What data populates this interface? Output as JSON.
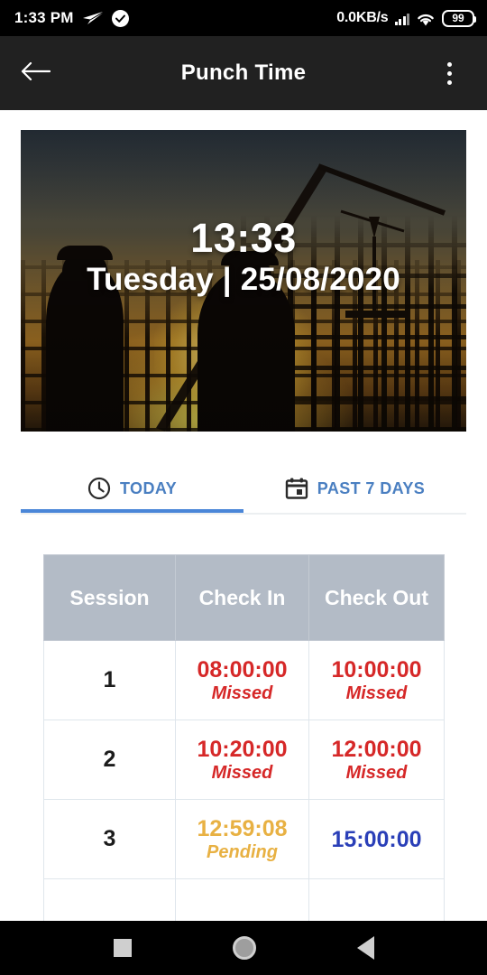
{
  "status_bar": {
    "time": "1:33 PM",
    "send_icon": "send-icon",
    "check_icon": "check-circle-icon",
    "network_speed": "0.0KB/s",
    "signal_icon": "signal-bars-icon",
    "wifi_icon": "wifi-icon",
    "battery_level": "99"
  },
  "app_bar": {
    "back_icon": "back-arrow-icon",
    "title": "Punch Time",
    "overflow_icon": "overflow-menu-icon"
  },
  "hero": {
    "time": "13:33",
    "date": "Tuesday | 25/08/2020"
  },
  "tabs": {
    "items": [
      {
        "label": "TODAY",
        "icon": "clock-icon",
        "active": true
      },
      {
        "label": "PAST 7 DAYS",
        "icon": "calendar-icon",
        "active": false
      }
    ]
  },
  "table": {
    "headers": [
      "Session",
      "Check In",
      "Check Out"
    ],
    "rows": [
      {
        "session": "1",
        "check_in": {
          "time": "08:00:00",
          "status": "Missed",
          "state": "missed"
        },
        "check_out": {
          "time": "10:00:00",
          "status": "Missed",
          "state": "missed"
        }
      },
      {
        "session": "2",
        "check_in": {
          "time": "10:20:00",
          "status": "Missed",
          "state": "missed"
        },
        "check_out": {
          "time": "12:00:00",
          "status": "Missed",
          "state": "missed"
        }
      },
      {
        "session": "3",
        "check_in": {
          "time": "12:59:08",
          "status": "Pending",
          "state": "pending"
        },
        "check_out": {
          "time": "15:00:00",
          "status": "",
          "state": "done"
        }
      }
    ]
  },
  "nav_bar": {
    "recents_icon": "recents-square-icon",
    "home_icon": "home-circle-icon",
    "back_icon": "back-triangle-icon"
  },
  "colors": {
    "accent_blue": "#4a86d8",
    "tab_text_blue": "#4a7fc1",
    "header_gray": "#b3bbc6",
    "missed_red": "#d62828",
    "pending_amber": "#e8b143",
    "done_blue": "#2a3fb8",
    "app_bar_dark": "#212121"
  }
}
